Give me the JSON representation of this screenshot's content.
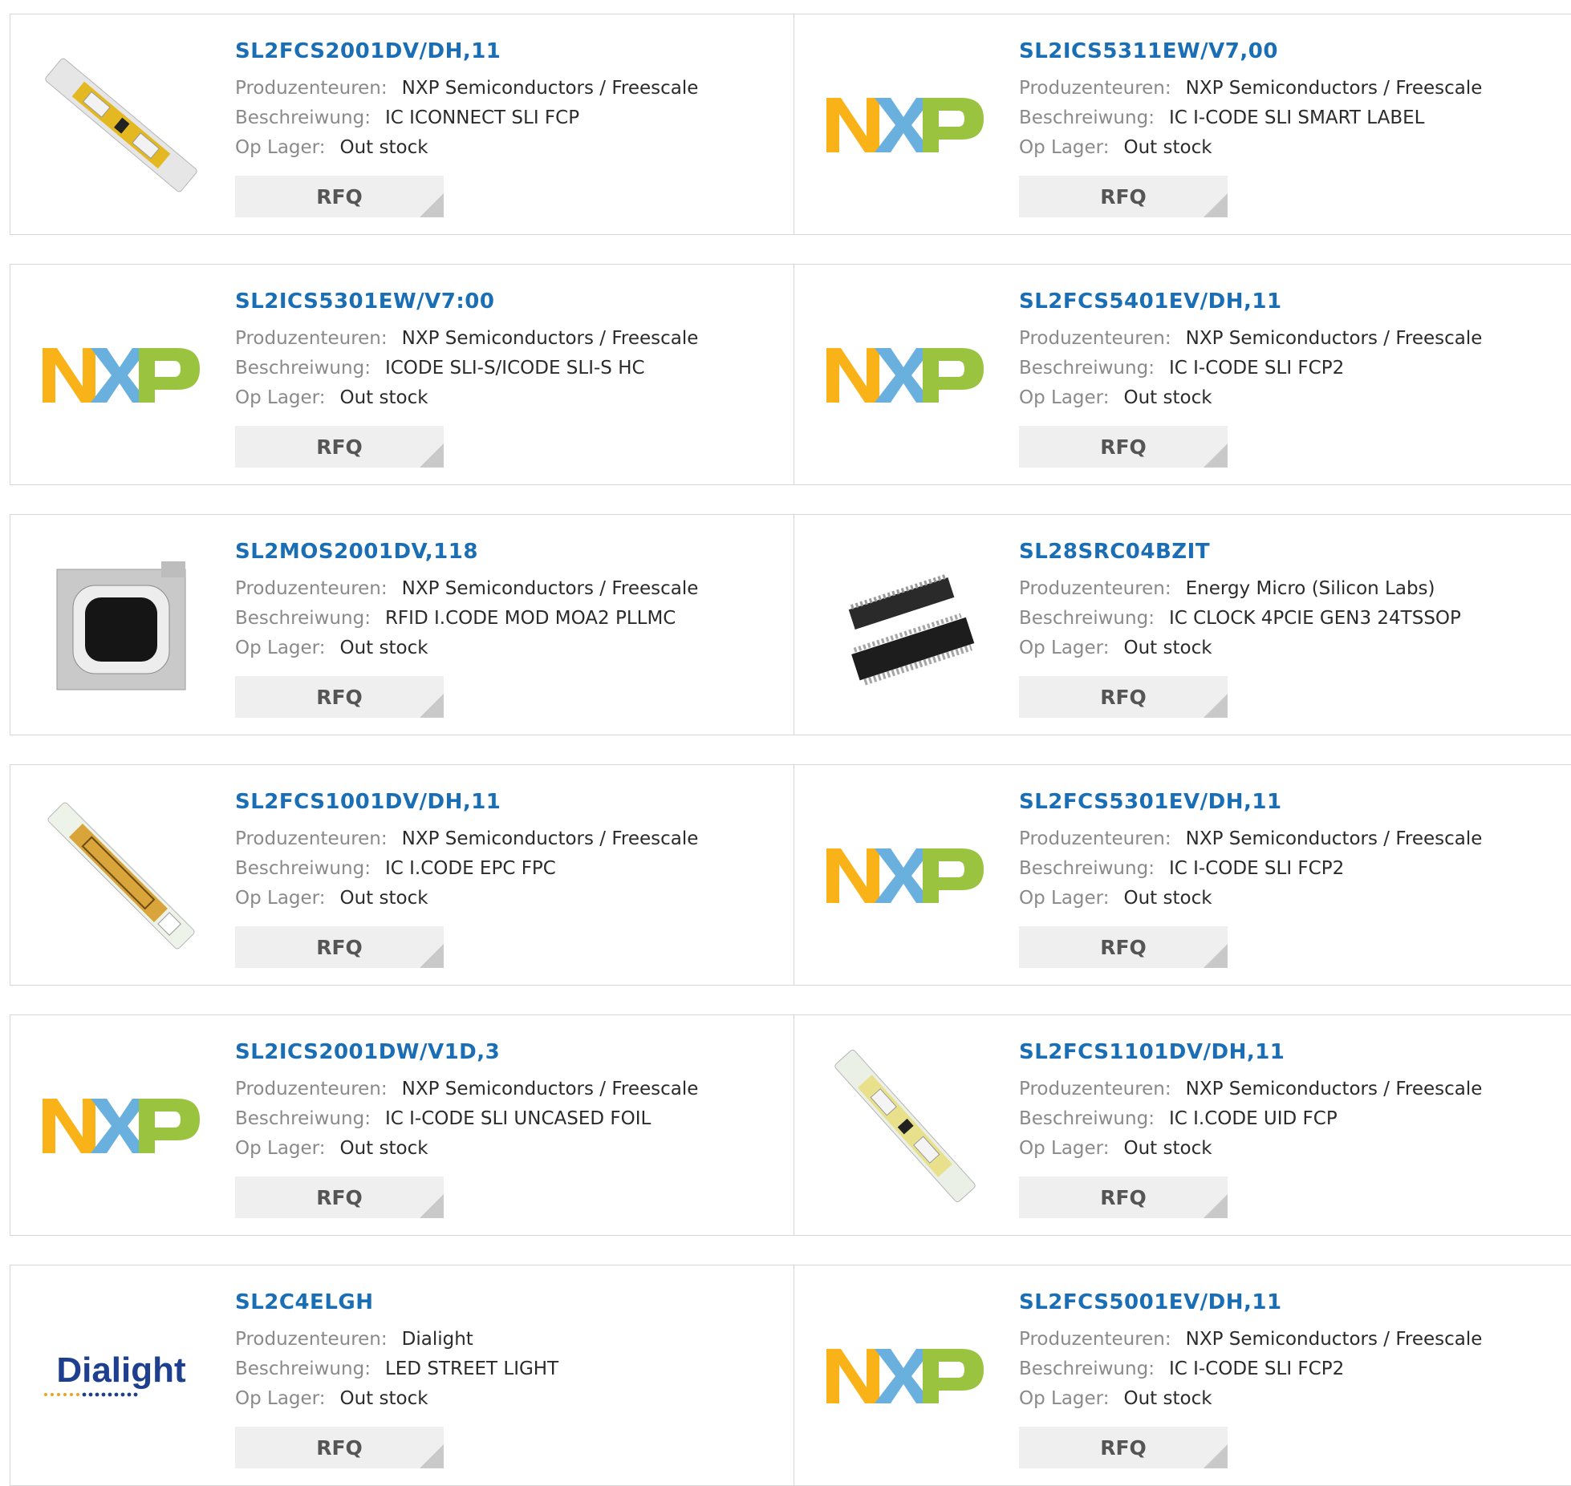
{
  "labels": {
    "producer": "Produzenteuren:",
    "description": "Beschreiwung:",
    "stock": "Op Lager:",
    "rfq": "RFQ"
  },
  "colors": {
    "part_link": "#1a6eb5",
    "label": "#8a8a8a",
    "value": "#2b2b2b",
    "nxp_orange": "#f9b218",
    "nxp_blue": "#6ab0de",
    "nxp_green": "#9ac440",
    "dialight_blue": "#1d3f8e"
  },
  "products": [
    {
      "part": "SL2FCS2001DV/DH,11",
      "producer": "NXP Semiconductors / Freescale",
      "description": "IC ICONNECT SLI FCP",
      "stock": "Out stock",
      "image": "rfid-strip-icon"
    },
    {
      "part": "SL2ICS5311EW/V7,00",
      "producer": "NXP Semiconductors / Freescale",
      "description": "IC I-CODE SLI SMART LABEL",
      "stock": "Out stock",
      "image": "nxp-logo"
    },
    {
      "part": "SL2ICS5301EW/V7:00",
      "producer": "NXP Semiconductors / Freescale",
      "description": "ICODE SLI-S/ICODE SLI-S HC",
      "stock": "Out stock",
      "image": "nxp-logo"
    },
    {
      "part": "SL2FCS5401EV/DH,11",
      "producer": "NXP Semiconductors / Freescale",
      "description": "IC I-CODE SLI FCP2",
      "stock": "Out stock",
      "image": "nxp-logo"
    },
    {
      "part": "SL2MOS2001DV,118",
      "producer": "NXP Semiconductors / Freescale",
      "description": "RFID I.CODE MOD MOA2 PLLMC",
      "stock": "Out stock",
      "image": "rfid-module-icon"
    },
    {
      "part": "SL28SRC04BZIT",
      "producer": "Energy Micro (Silicon Labs)",
      "description": "IC CLOCK 4PCIE GEN3 24TSSOP",
      "stock": "Out stock",
      "image": "tssop-chip-icon"
    },
    {
      "part": "SL2FCS1001DV/DH,11",
      "producer": "NXP Semiconductors / Freescale",
      "description": "IC I.CODE EPC FPC",
      "stock": "Out stock",
      "image": "rfid-strip-icon"
    },
    {
      "part": "SL2FCS5301EV/DH,11",
      "producer": "NXP Semiconductors / Freescale",
      "description": "IC I-CODE SLI FCP2",
      "stock": "Out stock",
      "image": "nxp-logo"
    },
    {
      "part": "SL2ICS2001DW/V1D,3",
      "producer": "NXP Semiconductors / Freescale",
      "description": "IC I-CODE SLI UNCASED FOIL",
      "stock": "Out stock",
      "image": "nxp-logo"
    },
    {
      "part": "SL2FCS1101DV/DH,11",
      "producer": "NXP Semiconductors / Freescale",
      "description": "IC I.CODE UID FCP",
      "stock": "Out stock",
      "image": "rfid-strip-icon"
    },
    {
      "part": "SL2C4ELGH",
      "producer": "Dialight",
      "description": "LED STREET LIGHT",
      "stock": "Out stock",
      "image": "dialight-logo",
      "logo_text": "Dialight"
    },
    {
      "part": "SL2FCS5001EV/DH,11",
      "producer": "NXP Semiconductors / Freescale",
      "description": "IC I-CODE SLI FCP2",
      "stock": "Out stock",
      "image": "nxp-logo"
    }
  ]
}
